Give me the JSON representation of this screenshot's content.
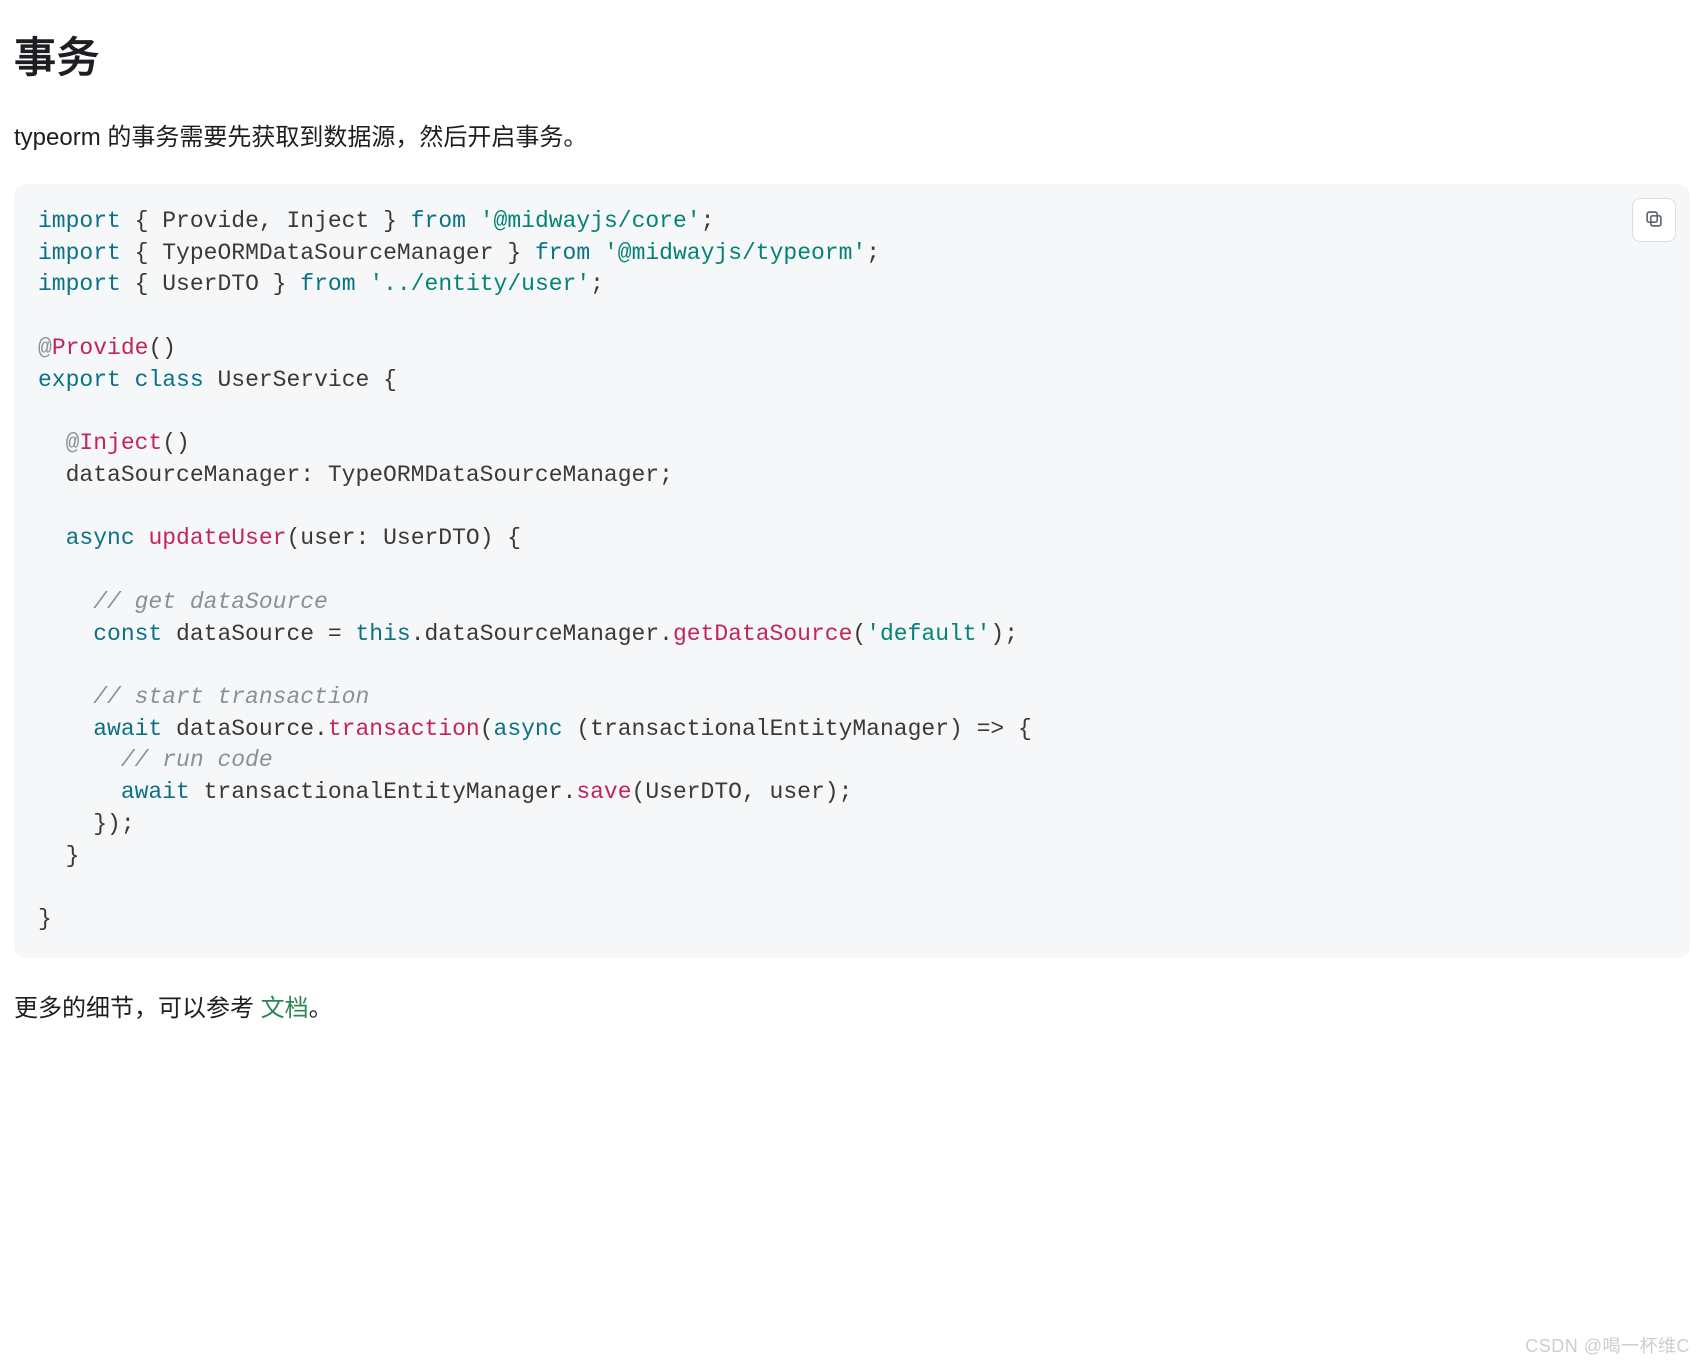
{
  "heading": "事务",
  "intro": "typeorm 的事务需要先获取到数据源，然后开启事务。",
  "code": {
    "l1": {
      "kw_import": "import",
      "brace_l": " { ",
      "names": "Provide, Inject",
      "brace_r": " } ",
      "kw_from": "from",
      "sp": " ",
      "str": "'@midwayjs/core'",
      "semi": ";"
    },
    "l2": {
      "kw_import": "import",
      "brace_l": " { ",
      "names": "TypeORMDataSourceManager",
      "brace_r": " } ",
      "kw_from": "from",
      "sp": " ",
      "str": "'@midwayjs/typeorm'",
      "semi": ";"
    },
    "l3": {
      "kw_import": "import",
      "brace_l": " { ",
      "names": "UserDTO",
      "brace_r": " } ",
      "kw_from": "from",
      "sp": " ",
      "str": "'../entity/user'",
      "semi": ";"
    },
    "blank1": "",
    "l4": {
      "at": "@",
      "dec": "Provide",
      "paren": "()"
    },
    "l5": {
      "kw_export": "export",
      "sp1": " ",
      "kw_class": "class",
      "sp2": " ",
      "name": "UserService",
      "sp3": " ",
      "brace": "{"
    },
    "blank2": "",
    "l6": {
      "indent": "  ",
      "at": "@",
      "dec": "Inject",
      "paren": "()"
    },
    "l7": {
      "indent": "  ",
      "body": "dataSourceManager: TypeORMDataSourceManager;"
    },
    "blank3": "",
    "l8": {
      "indent": "  ",
      "kw_async": "async",
      "sp": " ",
      "fn": "updateUser",
      "rest": "(user: UserDTO) {"
    },
    "blank4": "",
    "l9": {
      "indent": "    ",
      "cmt": "// get dataSource"
    },
    "l10": {
      "indent": "    ",
      "kw_const": "const",
      "mid1": " dataSource = ",
      "kw_this": "this",
      "mid2": ".dataSourceManager.",
      "fn": "getDataSource",
      "par_l": "(",
      "str": "'default'",
      "par_r": ");"
    },
    "blank5": "",
    "l11": {
      "indent": "    ",
      "cmt": "// start transaction"
    },
    "l12": {
      "indent": "    ",
      "kw_await": "await",
      "mid1": " dataSource.",
      "fn": "transaction",
      "par_l": "(",
      "kw_async": "async",
      "mid2": " (transactionalEntityManager) => {"
    },
    "l13": {
      "indent": "      ",
      "cmt": "// run code"
    },
    "l14": {
      "indent": "      ",
      "kw_await": "await",
      "mid1": " transactionalEntityManager.",
      "fn": "save",
      "rest": "(UserDTO, user);"
    },
    "l15": {
      "indent": "    ",
      "body": "});"
    },
    "l16": {
      "indent": "  ",
      "body": "}"
    },
    "blank6": "",
    "l17": {
      "body": "}"
    }
  },
  "outro_pre": "更多的细节，可以参考 ",
  "outro_link": "文档",
  "outro_post": "。",
  "watermark": "CSDN @喝一杯维C"
}
